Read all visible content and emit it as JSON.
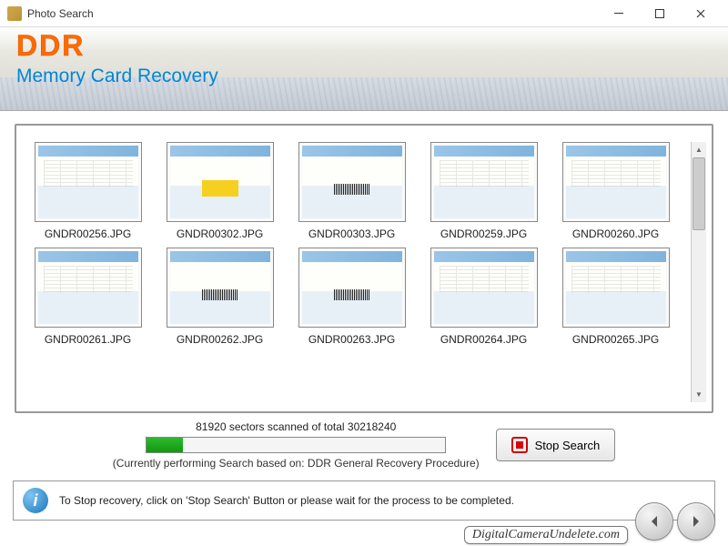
{
  "window": {
    "title": "Photo Search"
  },
  "banner": {
    "logo": "DDR",
    "subtitle": "Memory Card Recovery"
  },
  "thumbs": [
    {
      "label": "GNDR00256.JPG",
      "accent": ""
    },
    {
      "label": "GNDR00302.JPG",
      "accent": "yellow"
    },
    {
      "label": "GNDR00303.JPG",
      "accent": "barcode"
    },
    {
      "label": "GNDR00259.JPG",
      "accent": ""
    },
    {
      "label": "GNDR00260.JPG",
      "accent": ""
    },
    {
      "label": "GNDR00261.JPG",
      "accent": ""
    },
    {
      "label": "GNDR00262.JPG",
      "accent": "barcode"
    },
    {
      "label": "GNDR00263.JPG",
      "accent": "barcode"
    },
    {
      "label": "GNDR00264.JPG",
      "accent": ""
    },
    {
      "label": "GNDR00265.JPG",
      "accent": ""
    }
  ],
  "progress": {
    "status": "81920 sectors scanned of total 30218240",
    "note": "(Currently performing Search based on:  DDR General Recovery Procedure)",
    "stop_label": "Stop Search"
  },
  "footer": {
    "hint": "To Stop recovery, click on 'Stop Search' Button or please wait for the process to be completed."
  },
  "watermark": "DigitalCameraUndelete.com"
}
